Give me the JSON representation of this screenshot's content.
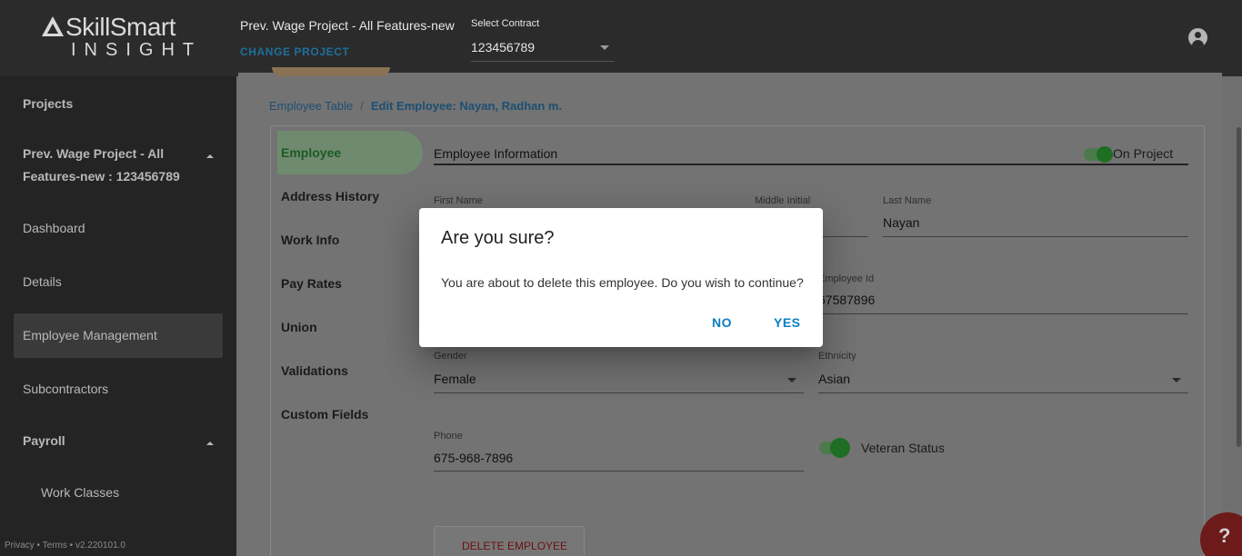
{
  "brand": {
    "name": "SkillSmart",
    "sub": "INSIGHT"
  },
  "header": {
    "project_title": "Prev. Wage Project - All Features-new",
    "change_project": "CHANGE PROJECT",
    "contract_label": "Select Contract",
    "contract_value": "123456789"
  },
  "sidebar": {
    "projects": "Projects",
    "project_line1": "Prev. Wage Project - All",
    "project_line2": "Features-new : 123456789",
    "dashboard": "Dashboard",
    "details": "Details",
    "employee_management": "Employee Management",
    "subcontractors": "Subcontractors",
    "payroll": "Payroll",
    "work_classes": "Work Classes",
    "footer": "Privacy • Terms • v2.220101.0"
  },
  "breadcrumb": {
    "root": "Employee Table",
    "separator": "/",
    "current": "Edit Employee: Nayan, Radhan m."
  },
  "tabs": [
    "Employee",
    "Address History",
    "Work Info",
    "Pay Rates",
    "Union",
    "Validations",
    "Custom Fields"
  ],
  "form": {
    "section_title": "Employee Information",
    "on_project_label": "On Project",
    "first_name_label": "First Name",
    "middle_initial_label": "Middle Initial",
    "last_name_label": "Last Name",
    "last_name_value": "Nayan",
    "employee_id_label": "Employee Id",
    "employee_id_value": "67587896",
    "gender_label": "Gender",
    "gender_value": "Female",
    "ethnicity_label": "Ethnicity",
    "ethnicity_value": "Asian",
    "phone_label": "Phone",
    "phone_value": "675-968-7896",
    "veteran_label": "Veteran Status",
    "delete_button": "DELETE EMPLOYEE"
  },
  "dialog": {
    "title": "Are you sure?",
    "message": "You are about to delete this employee. Do you wish to continue?",
    "no": "NO",
    "yes": "YES"
  },
  "help": {
    "label": "?"
  },
  "colors": {
    "accent": "#0b7fc4",
    "toggle_on": "#1f6e23",
    "danger": "#c62828"
  }
}
